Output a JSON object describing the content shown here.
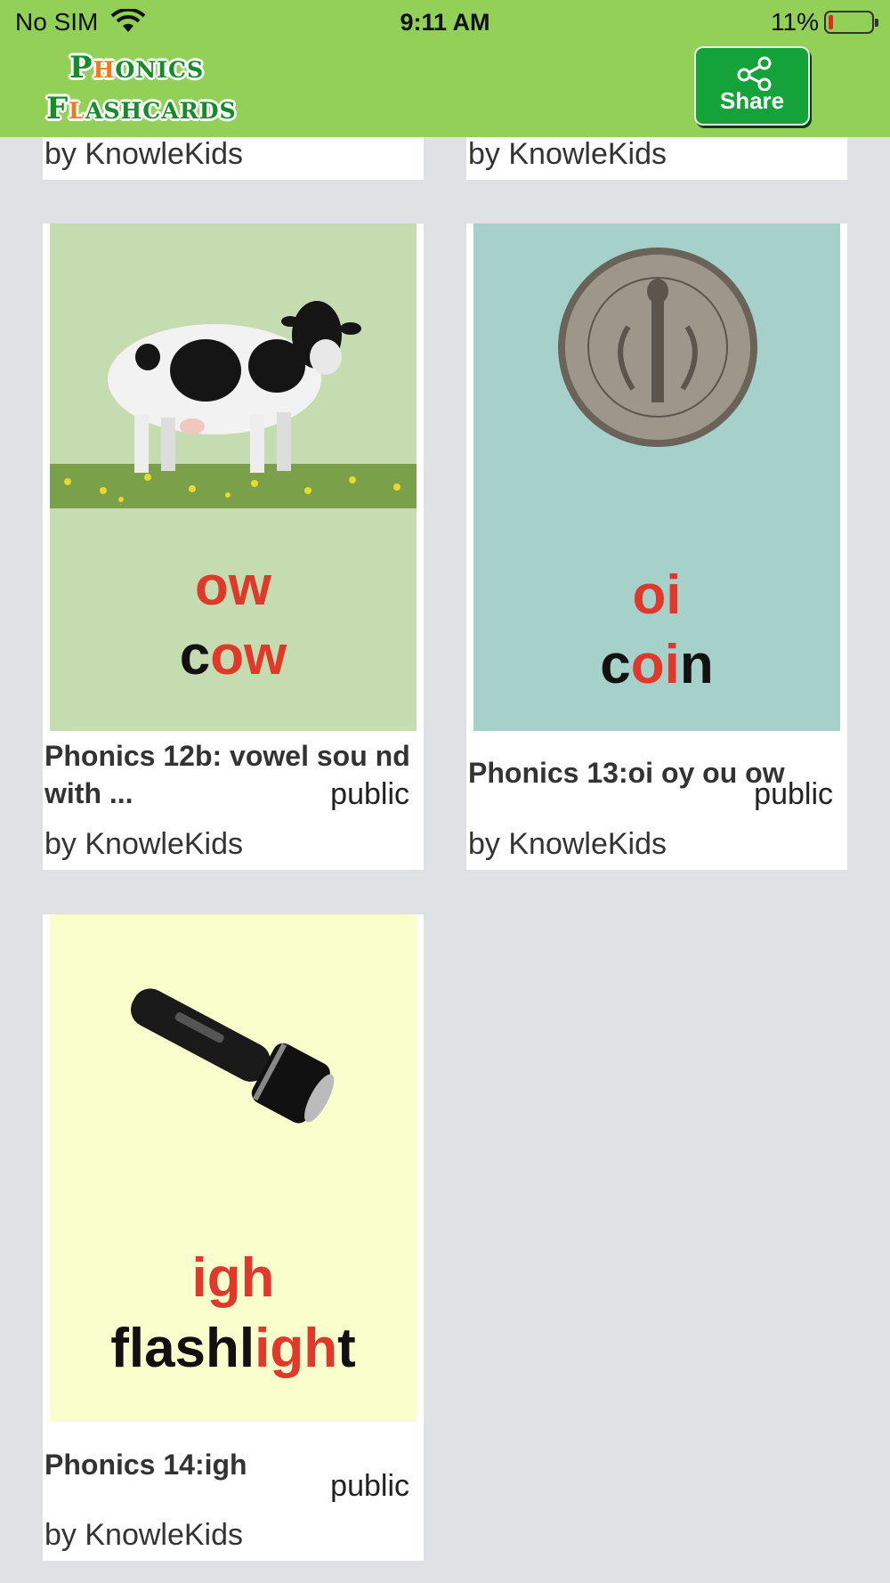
{
  "status_bar": {
    "carrier": "No SIM",
    "time": "9:11 AM",
    "battery": "11%",
    "battery_level": 0.11
  },
  "header": {
    "logo_line1_first": "P",
    "logo_line1_rest": "HONICS",
    "logo_line2_first": "F",
    "logo_line2_rest": "LASHCARDS",
    "share_label": "Share"
  },
  "colors": {
    "header_bg": "#92d058",
    "share_bg": "#14a23a",
    "accent_red": "#e0382a"
  },
  "partial_cards": [
    {
      "author": "by KnowleKids"
    },
    {
      "author": "by KnowleKids"
    }
  ],
  "cards": [
    {
      "title": "Phonics 12b: vowel sou nd with ...",
      "visibility": "public",
      "author": "by KnowleKids",
      "thumb_bg": "#c5dcb0",
      "image": "cow-photo",
      "sound": "ow",
      "word_pre": "c",
      "word_hl": "ow",
      "word_post": ""
    },
    {
      "title": "Phonics 13:oi oy ou ow",
      "visibility": "public",
      "author": "by KnowleKids",
      "thumb_bg": "#a6d1cb",
      "image": "dime-coin-photo",
      "sound": "oi",
      "word_pre": "c",
      "word_hl": "oi",
      "word_post": "n"
    },
    {
      "title": "Phonics 14:igh",
      "visibility": "public",
      "author": "by KnowleKids",
      "thumb_bg": "#f8ffcc",
      "image": "flashlight-photo",
      "sound": "igh",
      "word_pre": "flashl",
      "word_hl": "igh",
      "word_post": "t"
    }
  ]
}
